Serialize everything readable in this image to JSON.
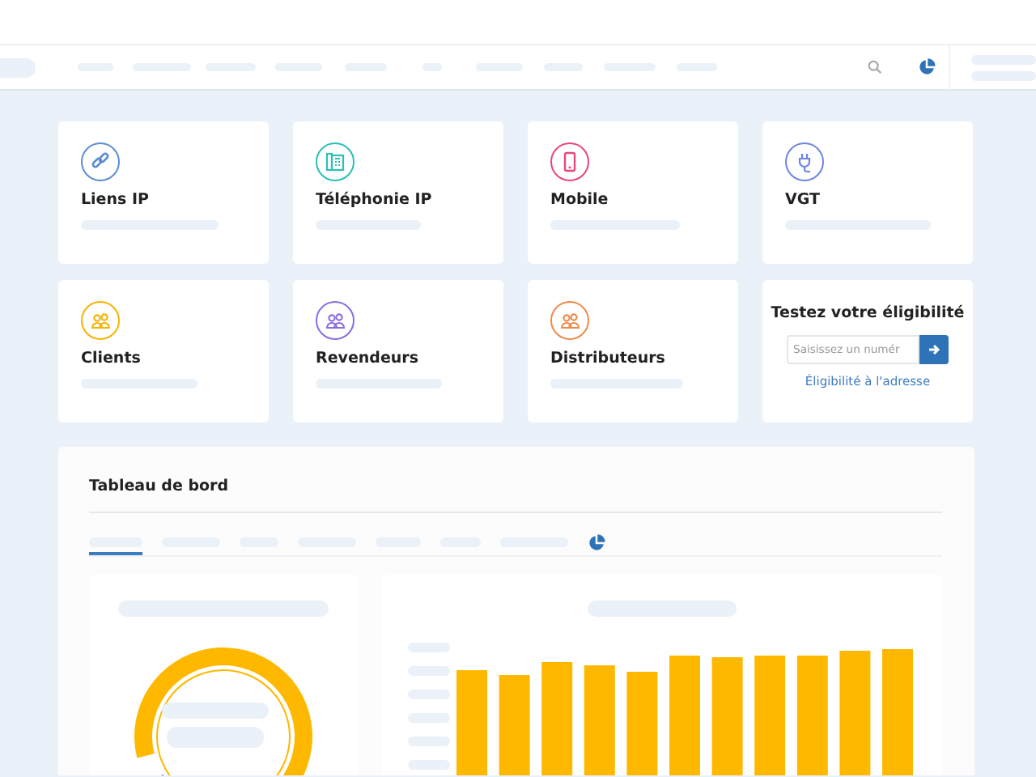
{
  "services": [
    {
      "kind": "link",
      "title": "Liens IP",
      "color": "#5b8fd0"
    },
    {
      "kind": "phone",
      "title": "Téléphonie IP",
      "color": "#2bbfb5"
    },
    {
      "kind": "mobile",
      "title": "Mobile",
      "color": "#e8467c"
    },
    {
      "kind": "plug",
      "title": "VGT",
      "color": "#6d86e0"
    },
    {
      "kind": "people",
      "title": "Clients",
      "color": "#f5b400"
    },
    {
      "kind": "people",
      "title": "Revendeurs",
      "color": "#8b6de0"
    },
    {
      "kind": "people",
      "title": "Distributeurs",
      "color": "#f08a4b"
    }
  ],
  "eligibility": {
    "title": "Testez votre éligibilité",
    "placeholder": "Saisissez un numér",
    "link": "Éligibilité à l'adresse"
  },
  "dashboard": {
    "title": "Tableau de bord",
    "tabs": [
      {
        "selected": true
      },
      {
        "selected": false
      },
      {
        "selected": false
      },
      {
        "selected": false
      },
      {
        "selected": false
      },
      {
        "selected": false
      },
      {
        "selected": false
      }
    ]
  }
}
